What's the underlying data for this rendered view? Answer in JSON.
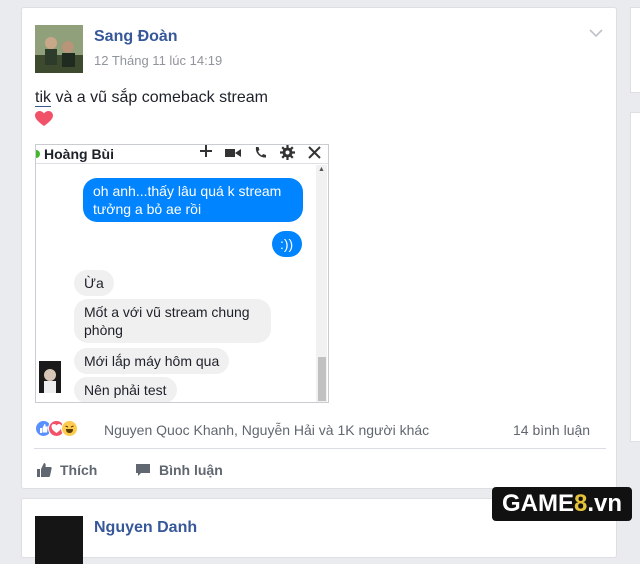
{
  "post": {
    "author": "Sang Đoàn",
    "timestamp": "12 Tháng 11 lúc 14:19",
    "text_tag": "tik",
    "text_rest": " và a vũ sắp comeback stream",
    "reactions_text": "Nguyen Quoc Khanh, Nguyễn Hải và 1K người khác",
    "comments_count": "14 bình luận",
    "actions": {
      "like": "Thích",
      "comment": "Bình luận"
    }
  },
  "chat": {
    "title": "Hoàng Bùi",
    "messages": [
      {
        "side": "out",
        "text": "oh anh...thấy lâu quá k stream tưởng a bỏ ae rồi"
      },
      {
        "side": "out",
        "text": ":))"
      },
      {
        "side": "in",
        "text": "Ừa"
      },
      {
        "side": "in",
        "text": "Mốt a với vũ stream chung phòng"
      },
      {
        "side": "in",
        "text": "Mới lắp máy hôm qua"
      },
      {
        "side": "in",
        "text": "Nên phải test"
      }
    ]
  },
  "next_post": {
    "author": "Nguyen Danh"
  },
  "watermark": {
    "main": "GAME",
    "num": "8",
    "suffix": ".vn"
  },
  "colors": {
    "link": "#365899",
    "messenger_blue": "#0084ff",
    "like_blue": "#5890ff",
    "love_red": "#f25268",
    "haha_yellow": "#fdcb4d"
  },
  "icons": [
    "chevron-down-icon",
    "heart-icon",
    "plus-icon",
    "video-icon",
    "phone-icon",
    "gear-icon",
    "close-icon",
    "like-icon",
    "comment-icon"
  ]
}
